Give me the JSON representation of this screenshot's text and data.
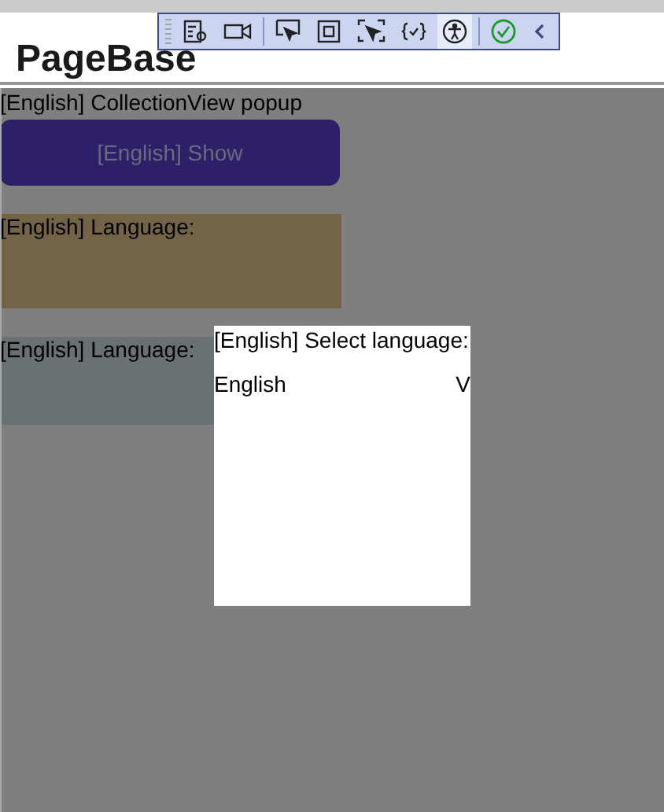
{
  "page": {
    "title": "PageBase"
  },
  "toolbar": {
    "tools": [
      {
        "kind": "live-tree",
        "selected": false
      },
      {
        "kind": "camera",
        "selected": false
      },
      {
        "kind": "select",
        "selected": false
      },
      {
        "kind": "layout",
        "selected": false
      },
      {
        "kind": "track",
        "selected": false
      },
      {
        "kind": "binding",
        "selected": false
      },
      {
        "kind": "accessibility",
        "selected": true
      },
      {
        "kind": "check",
        "selected": false
      },
      {
        "kind": "collapse",
        "selected": false
      }
    ]
  },
  "content": {
    "heading": "[English] CollectionView popup",
    "button": "[English] Show",
    "language_label_1": "[English] Language:",
    "language_label_2": "[English] Language:"
  },
  "popup": {
    "title": "[English] Select language:",
    "items": [
      {
        "label": "English",
        "marker": "V"
      }
    ]
  }
}
